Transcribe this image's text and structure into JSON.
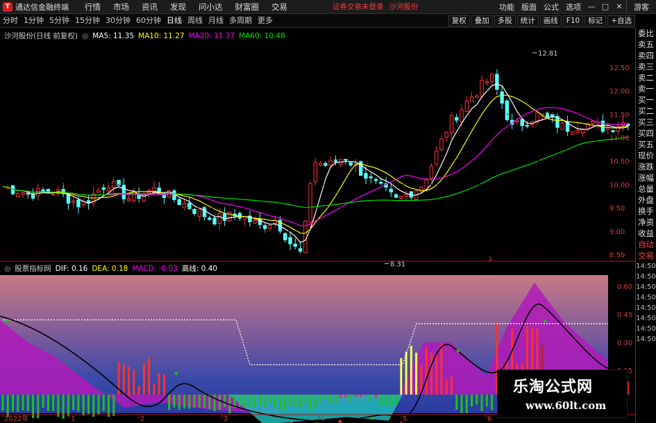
{
  "menubar": {
    "app_title": "通达信金融终端",
    "items": [
      "行情",
      "市场",
      "资讯",
      "发现",
      "问小达",
      "财富圈",
      "交易"
    ],
    "login_warning": "证券交易未登录",
    "stock_name": "沙河股份",
    "right_items": [
      "功能",
      "版面",
      "公式",
      "选项"
    ],
    "guest": "游客"
  },
  "periods": [
    "分时",
    "1分钟",
    "5分钟",
    "15分钟",
    "30分钟",
    "60分钟",
    "日线",
    "周线",
    "月线",
    "多周期",
    "更多"
  ],
  "toolbar": [
    "复权",
    "叠加",
    "多股",
    "统计",
    "画线",
    "F10",
    "标记",
    "+自选"
  ],
  "legend_top": {
    "title": "沙河股份(日线 前复权)",
    "ma5": "MA5: 11.35",
    "ma10": "MA10: 11.27",
    "ma20": "MA20: 11.37",
    "ma60": "MA60: 10.48"
  },
  "legend_bottom": {
    "title": "股票指标网",
    "dif": "DIF: 0.16",
    "dea": "DEA: 0.18",
    "macd": "MACD: -0.03",
    "high": "高线: 0.40"
  },
  "side_panel": {
    "items": [
      "委比",
      "卖五",
      "卖四",
      "卖三",
      "卖二",
      "卖一",
      "买一",
      "买二",
      "买三",
      "买四",
      "买五",
      "现价",
      "涨跌",
      "涨幅",
      "总量",
      "外盘",
      "换手",
      "净资",
      "收益"
    ],
    "items2": [
      "自动",
      "交易"
    ],
    "times": [
      "14:50",
      "14:50",
      "14:50",
      "14:50",
      "14:50",
      "14:50",
      "14:50",
      "14:50"
    ]
  },
  "price_axis": [
    "12.50",
    "12.00",
    "11.50",
    "11.00",
    "10.50",
    "10.00",
    "9.50",
    "9.00",
    "8.50"
  ],
  "indicator_axis": [
    "0.60",
    "0.45",
    "0.30",
    "0.15"
  ],
  "annotations": {
    "high": "12.81",
    "low": "8.31",
    "marker": "3"
  },
  "date_axis": [
    "2022年",
    "1",
    "2",
    "3",
    "4",
    "5",
    "6"
  ],
  "colors": {
    "up": "#ff3333",
    "down": "#54ffff",
    "ma5": "#ffffff",
    "ma10": "#ffff00",
    "ma20": "#ff00ff",
    "ma60": "#00e600"
  },
  "watermark": {
    "cn": "乐淘公式网",
    "url": "www.60lt.com"
  }
}
